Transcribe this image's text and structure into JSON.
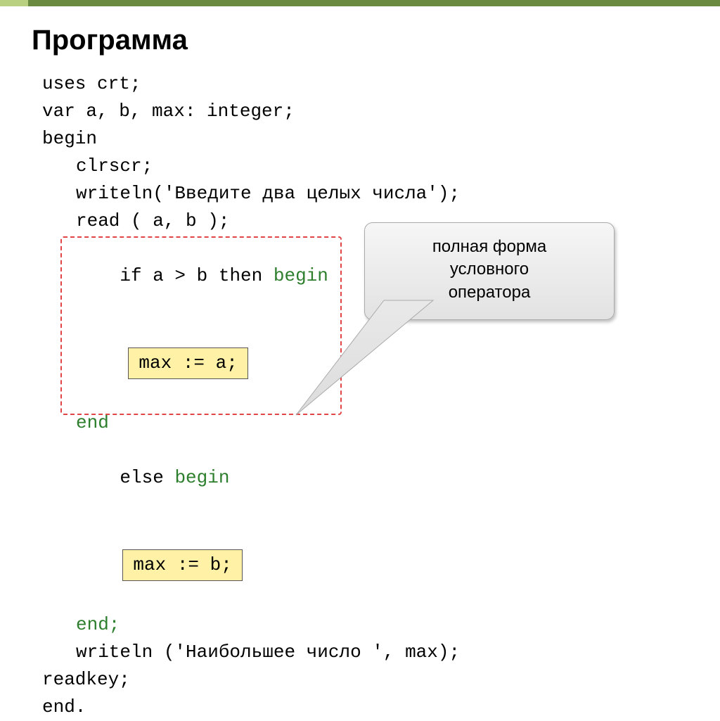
{
  "title": "Программа",
  "code": {
    "l1": "uses crt;",
    "l2": "var a, b, max: integer;",
    "l3": "begin",
    "l4": "clrscr;",
    "l5": "writeln('Введите два целых числа');",
    "l6": "read ( a, b );",
    "l7_if": "if a > b then ",
    "l7_begin": "begin",
    "l8_box": "max := a;",
    "l9": "end",
    "l10_else": "else ",
    "l10_begin": "begin",
    "l11_box": "max := b;",
    "l12": "end;",
    "l13": "writeln ('Наибольшее число ', max);",
    "l14": "readkey;",
    "l15": "end."
  },
  "callout": {
    "line1": "полная форма",
    "line2": "условного",
    "line3": "оператора"
  }
}
